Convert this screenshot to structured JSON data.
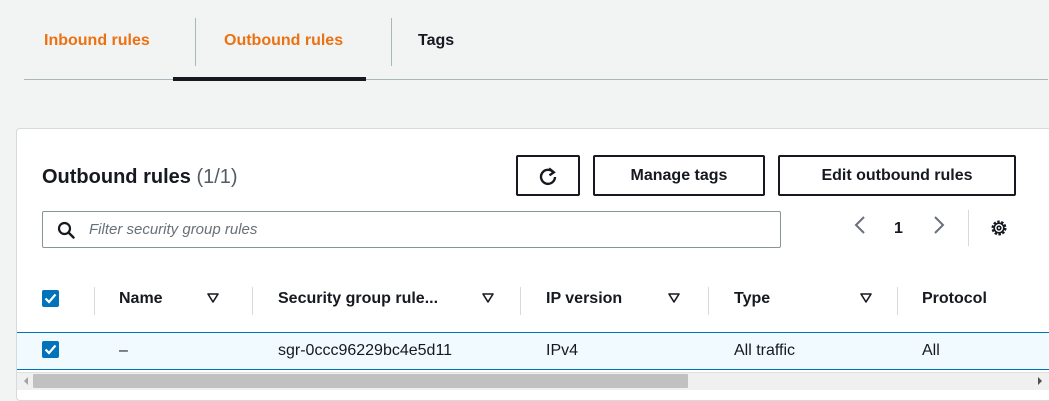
{
  "tabs": [
    {
      "label": "Inbound rules",
      "active": false
    },
    {
      "label": "Outbound rules",
      "active": true
    },
    {
      "label": "Tags",
      "active": false
    }
  ],
  "panel": {
    "title": "Outbound rules",
    "count": "(1/1)"
  },
  "buttons": {
    "refresh": "refresh-icon",
    "manage_tags": "Manage tags",
    "edit_outbound_rules": "Edit outbound rules"
  },
  "search": {
    "placeholder": "Filter security group rules",
    "value": ""
  },
  "pagination": {
    "current_page": "1"
  },
  "table": {
    "columns": [
      "Name",
      "Security group rule...",
      "IP version",
      "Type",
      "Protocol"
    ],
    "rows": [
      {
        "selected": true,
        "name": "–",
        "security_group_rule": "sgr-0ccc96229bc4e5d11",
        "ip_version": "IPv4",
        "type": "All traffic",
        "protocol": "All"
      }
    ]
  },
  "colors": {
    "accent_orange": "#ec7211",
    "selection_blue": "#0073bb",
    "row_highlight": "#f1faff"
  }
}
